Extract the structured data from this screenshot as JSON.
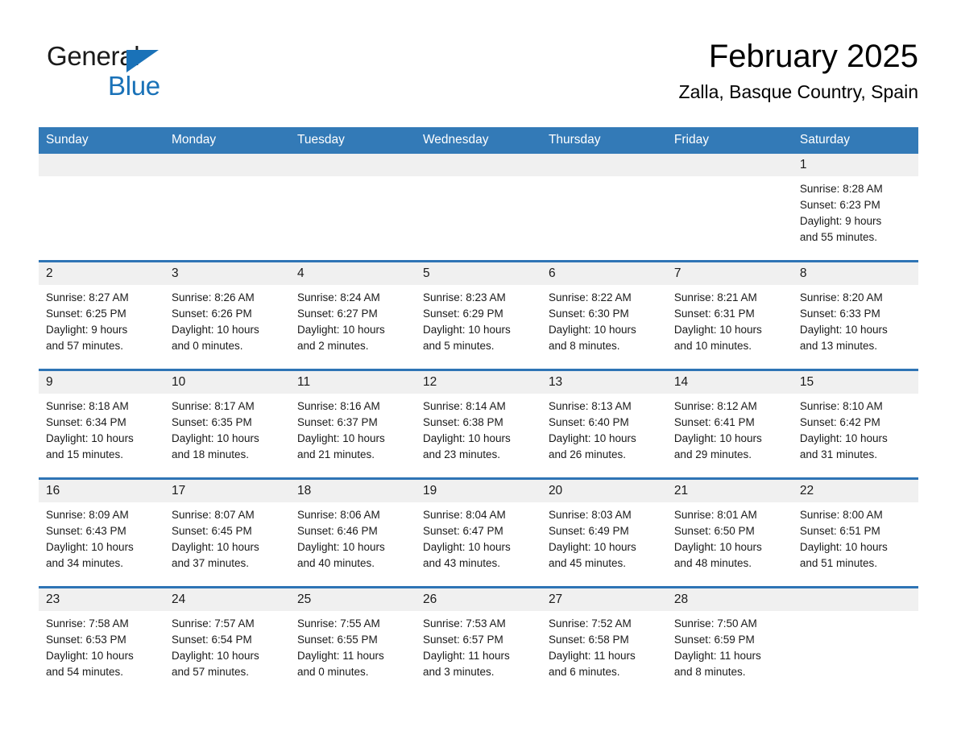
{
  "brand": {
    "name_part1": "General",
    "name_part2": "Blue",
    "triangle_color": "#1a72b8"
  },
  "header": {
    "title": "February 2025",
    "subtitle": "Zalla, Basque Country, Spain"
  },
  "colors": {
    "header_blue": "#337ab7",
    "row_divider_blue": "#2e74b5",
    "daynum_band": "#f0f0f0"
  },
  "weekday_headers": [
    "Sunday",
    "Monday",
    "Tuesday",
    "Wednesday",
    "Thursday",
    "Friday",
    "Saturday"
  ],
  "weeks": [
    [
      {
        "blank": true,
        "day": "",
        "sunrise": "",
        "sunset": "",
        "daylight_line1": "",
        "daylight_line2": ""
      },
      {
        "blank": true,
        "day": "",
        "sunrise": "",
        "sunset": "",
        "daylight_line1": "",
        "daylight_line2": ""
      },
      {
        "blank": true,
        "day": "",
        "sunrise": "",
        "sunset": "",
        "daylight_line1": "",
        "daylight_line2": ""
      },
      {
        "blank": true,
        "day": "",
        "sunrise": "",
        "sunset": "",
        "daylight_line1": "",
        "daylight_line2": ""
      },
      {
        "blank": true,
        "day": "",
        "sunrise": "",
        "sunset": "",
        "daylight_line1": "",
        "daylight_line2": ""
      },
      {
        "blank": true,
        "day": "",
        "sunrise": "",
        "sunset": "",
        "daylight_line1": "",
        "daylight_line2": ""
      },
      {
        "blank": false,
        "day": "1",
        "sunrise": "Sunrise: 8:28 AM",
        "sunset": "Sunset: 6:23 PM",
        "daylight_line1": "Daylight: 9 hours",
        "daylight_line2": "and 55 minutes."
      }
    ],
    [
      {
        "blank": false,
        "day": "2",
        "sunrise": "Sunrise: 8:27 AM",
        "sunset": "Sunset: 6:25 PM",
        "daylight_line1": "Daylight: 9 hours",
        "daylight_line2": "and 57 minutes."
      },
      {
        "blank": false,
        "day": "3",
        "sunrise": "Sunrise: 8:26 AM",
        "sunset": "Sunset: 6:26 PM",
        "daylight_line1": "Daylight: 10 hours",
        "daylight_line2": "and 0 minutes."
      },
      {
        "blank": false,
        "day": "4",
        "sunrise": "Sunrise: 8:24 AM",
        "sunset": "Sunset: 6:27 PM",
        "daylight_line1": "Daylight: 10 hours",
        "daylight_line2": "and 2 minutes."
      },
      {
        "blank": false,
        "day": "5",
        "sunrise": "Sunrise: 8:23 AM",
        "sunset": "Sunset: 6:29 PM",
        "daylight_line1": "Daylight: 10 hours",
        "daylight_line2": "and 5 minutes."
      },
      {
        "blank": false,
        "day": "6",
        "sunrise": "Sunrise: 8:22 AM",
        "sunset": "Sunset: 6:30 PM",
        "daylight_line1": "Daylight: 10 hours",
        "daylight_line2": "and 8 minutes."
      },
      {
        "blank": false,
        "day": "7",
        "sunrise": "Sunrise: 8:21 AM",
        "sunset": "Sunset: 6:31 PM",
        "daylight_line1": "Daylight: 10 hours",
        "daylight_line2": "and 10 minutes."
      },
      {
        "blank": false,
        "day": "8",
        "sunrise": "Sunrise: 8:20 AM",
        "sunset": "Sunset: 6:33 PM",
        "daylight_line1": "Daylight: 10 hours",
        "daylight_line2": "and 13 minutes."
      }
    ],
    [
      {
        "blank": false,
        "day": "9",
        "sunrise": "Sunrise: 8:18 AM",
        "sunset": "Sunset: 6:34 PM",
        "daylight_line1": "Daylight: 10 hours",
        "daylight_line2": "and 15 minutes."
      },
      {
        "blank": false,
        "day": "10",
        "sunrise": "Sunrise: 8:17 AM",
        "sunset": "Sunset: 6:35 PM",
        "daylight_line1": "Daylight: 10 hours",
        "daylight_line2": "and 18 minutes."
      },
      {
        "blank": false,
        "day": "11",
        "sunrise": "Sunrise: 8:16 AM",
        "sunset": "Sunset: 6:37 PM",
        "daylight_line1": "Daylight: 10 hours",
        "daylight_line2": "and 21 minutes."
      },
      {
        "blank": false,
        "day": "12",
        "sunrise": "Sunrise: 8:14 AM",
        "sunset": "Sunset: 6:38 PM",
        "daylight_line1": "Daylight: 10 hours",
        "daylight_line2": "and 23 minutes."
      },
      {
        "blank": false,
        "day": "13",
        "sunrise": "Sunrise: 8:13 AM",
        "sunset": "Sunset: 6:40 PM",
        "daylight_line1": "Daylight: 10 hours",
        "daylight_line2": "and 26 minutes."
      },
      {
        "blank": false,
        "day": "14",
        "sunrise": "Sunrise: 8:12 AM",
        "sunset": "Sunset: 6:41 PM",
        "daylight_line1": "Daylight: 10 hours",
        "daylight_line2": "and 29 minutes."
      },
      {
        "blank": false,
        "day": "15",
        "sunrise": "Sunrise: 8:10 AM",
        "sunset": "Sunset: 6:42 PM",
        "daylight_line1": "Daylight: 10 hours",
        "daylight_line2": "and 31 minutes."
      }
    ],
    [
      {
        "blank": false,
        "day": "16",
        "sunrise": "Sunrise: 8:09 AM",
        "sunset": "Sunset: 6:43 PM",
        "daylight_line1": "Daylight: 10 hours",
        "daylight_line2": "and 34 minutes."
      },
      {
        "blank": false,
        "day": "17",
        "sunrise": "Sunrise: 8:07 AM",
        "sunset": "Sunset: 6:45 PM",
        "daylight_line1": "Daylight: 10 hours",
        "daylight_line2": "and 37 minutes."
      },
      {
        "blank": false,
        "day": "18",
        "sunrise": "Sunrise: 8:06 AM",
        "sunset": "Sunset: 6:46 PM",
        "daylight_line1": "Daylight: 10 hours",
        "daylight_line2": "and 40 minutes."
      },
      {
        "blank": false,
        "day": "19",
        "sunrise": "Sunrise: 8:04 AM",
        "sunset": "Sunset: 6:47 PM",
        "daylight_line1": "Daylight: 10 hours",
        "daylight_line2": "and 43 minutes."
      },
      {
        "blank": false,
        "day": "20",
        "sunrise": "Sunrise: 8:03 AM",
        "sunset": "Sunset: 6:49 PM",
        "daylight_line1": "Daylight: 10 hours",
        "daylight_line2": "and 45 minutes."
      },
      {
        "blank": false,
        "day": "21",
        "sunrise": "Sunrise: 8:01 AM",
        "sunset": "Sunset: 6:50 PM",
        "daylight_line1": "Daylight: 10 hours",
        "daylight_line2": "and 48 minutes."
      },
      {
        "blank": false,
        "day": "22",
        "sunrise": "Sunrise: 8:00 AM",
        "sunset": "Sunset: 6:51 PM",
        "daylight_line1": "Daylight: 10 hours",
        "daylight_line2": "and 51 minutes."
      }
    ],
    [
      {
        "blank": false,
        "day": "23",
        "sunrise": "Sunrise: 7:58 AM",
        "sunset": "Sunset: 6:53 PM",
        "daylight_line1": "Daylight: 10 hours",
        "daylight_line2": "and 54 minutes."
      },
      {
        "blank": false,
        "day": "24",
        "sunrise": "Sunrise: 7:57 AM",
        "sunset": "Sunset: 6:54 PM",
        "daylight_line1": "Daylight: 10 hours",
        "daylight_line2": "and 57 minutes."
      },
      {
        "blank": false,
        "day": "25",
        "sunrise": "Sunrise: 7:55 AM",
        "sunset": "Sunset: 6:55 PM",
        "daylight_line1": "Daylight: 11 hours",
        "daylight_line2": "and 0 minutes."
      },
      {
        "blank": false,
        "day": "26",
        "sunrise": "Sunrise: 7:53 AM",
        "sunset": "Sunset: 6:57 PM",
        "daylight_line1": "Daylight: 11 hours",
        "daylight_line2": "and 3 minutes."
      },
      {
        "blank": false,
        "day": "27",
        "sunrise": "Sunrise: 7:52 AM",
        "sunset": "Sunset: 6:58 PM",
        "daylight_line1": "Daylight: 11 hours",
        "daylight_line2": "and 6 minutes."
      },
      {
        "blank": false,
        "day": "28",
        "sunrise": "Sunrise: 7:50 AM",
        "sunset": "Sunset: 6:59 PM",
        "daylight_line1": "Daylight: 11 hours",
        "daylight_line2": "and 8 minutes."
      },
      {
        "blank": true,
        "day": "",
        "sunrise": "",
        "sunset": "",
        "daylight_line1": "",
        "daylight_line2": ""
      }
    ]
  ]
}
